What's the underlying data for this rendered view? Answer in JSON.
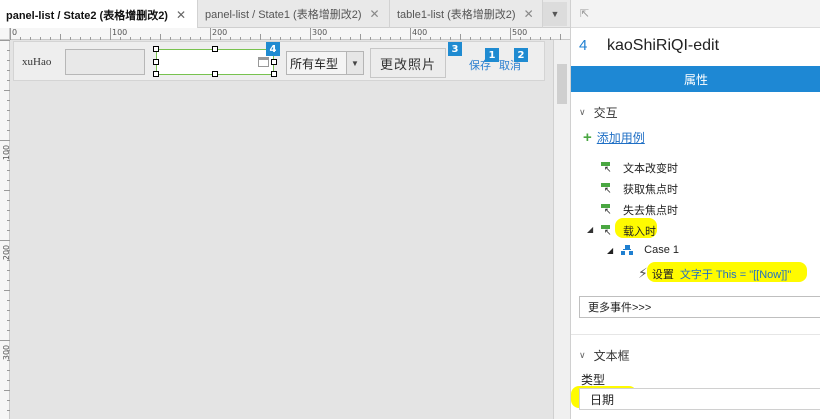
{
  "tabs": [
    {
      "label": "panel-list / State2 (表格增删改2)",
      "active": true
    },
    {
      "label": "panel-list / State1 (表格增删改2)",
      "active": false
    },
    {
      "label": "table1-list (表格增删改2)",
      "active": false
    }
  ],
  "tab_close_glyph": "✕",
  "rulers": {
    "horizontal": [
      "0",
      "100",
      "200",
      "300",
      "400",
      "500"
    ],
    "vertical": [
      "100",
      "200",
      "300"
    ]
  },
  "canvas": {
    "xuhao_label": "xuHao",
    "xuhao_value": "",
    "date_value": "",
    "car_select": {
      "selected": "所有车型"
    },
    "photo_button": "更改照片",
    "save_link": "保存",
    "cancel_link": "取消",
    "badges": {
      "date": "4",
      "photo": "3",
      "save": "1",
      "cancel": "2"
    }
  },
  "inspector": {
    "widget_number": "4",
    "widget_name": "kaoShiRiQI-edit",
    "properties_tab": "属性",
    "interaction_section": "交互",
    "add_case": "添加用例",
    "events": [
      "文本改变时",
      "获取焦点时",
      "失去焦点时",
      "载入时"
    ],
    "case_name": "Case 1",
    "action": {
      "verb": "设置",
      "detail": "文字于 This = \"[[Now]]\""
    },
    "more_events": "更多事件>>>",
    "textbox_section": "文本框",
    "type_label": "类型",
    "type_value": "日期"
  },
  "colors": {
    "accent_blue": "#1e88d4",
    "highlight_yellow": "#fffb00",
    "selection_green": "#78c24f",
    "event_icon_green": "#4aa742"
  },
  "icons": [
    "close-icon",
    "dropdown-icon",
    "collapse-icon",
    "plus-icon",
    "event-icon",
    "case-icon",
    "lightning-icon",
    "calendar-icon",
    "chevron-down-icon"
  ]
}
